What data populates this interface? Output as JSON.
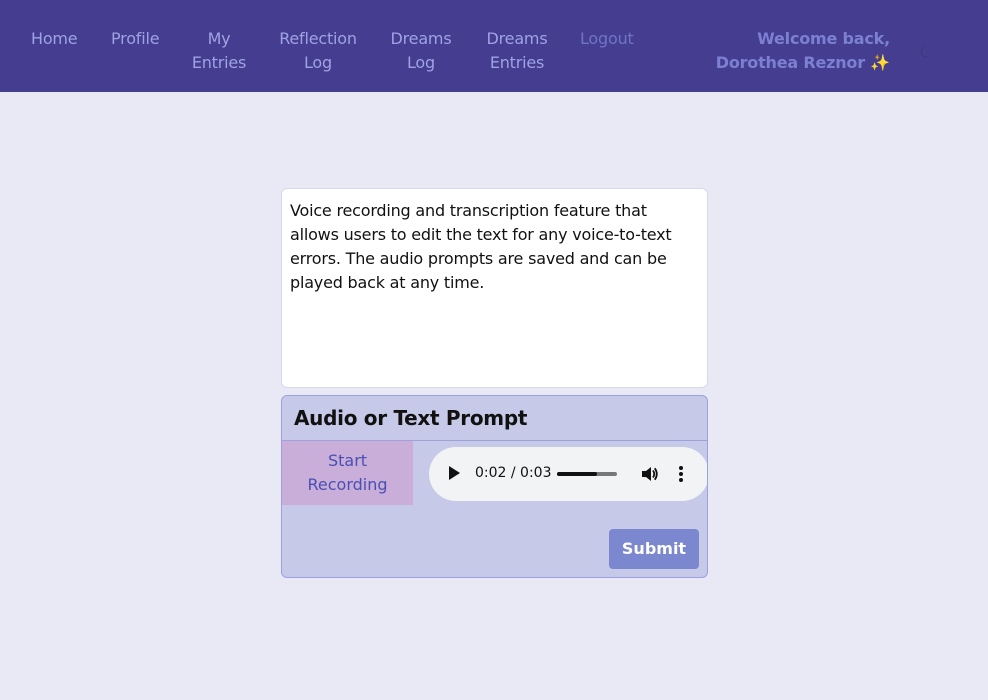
{
  "nav": {
    "items": [
      {
        "label": "Home"
      },
      {
        "label": "Profile"
      },
      {
        "label": "My\nEntries"
      },
      {
        "label": "Reflection\nLog"
      },
      {
        "label": "Dreams\nLog"
      },
      {
        "label": "Dreams\nEntries"
      },
      {
        "label": "Logout"
      }
    ],
    "welcome": "Welcome back,\nDorothea Reznor ✨",
    "theme_icon": "moon-icon"
  },
  "prompt": {
    "text": "Voice recording and transcription feature that allows users to edit the text for any voice-to-text errors. The audio prompts are saved and can be played back at any time."
  },
  "card": {
    "title": "Audio or Text Prompt",
    "record_label": "Start\nRecording",
    "audio": {
      "time": "0:02 / 0:03",
      "progress": 0.67
    },
    "submit_label": "Submit"
  },
  "colors": {
    "nav_bg": "#453d8f",
    "page_bg": "#e8e9f5",
    "card_bg": "#c6c9e8",
    "record_bg": "#c8aed8",
    "submit_bg": "#7b87cf"
  }
}
